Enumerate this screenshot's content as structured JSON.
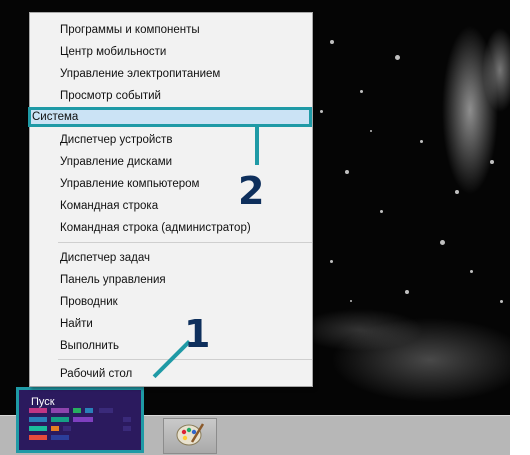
{
  "context_menu": {
    "items": [
      "Программы и компоненты",
      "Центр мобильности",
      "Управление электропитанием",
      "Просмотр событий",
      "Система",
      "Диспетчер устройств",
      "Управление дисками",
      "Управление компьютером",
      "Командная строка",
      "Командная строка (администратор)",
      "Диспетчер задач",
      "Панель управления",
      "Проводник",
      "Найти",
      "Выполнить",
      "Рабочий стол"
    ],
    "highlighted_index": 4
  },
  "start_button": {
    "label": "Пуск"
  },
  "callouts": {
    "one": "1",
    "two": "2"
  },
  "taskbar": {
    "apps": [
      "paint-icon"
    ]
  },
  "colors": {
    "accent": "#1f9aa6",
    "start_bg": "#2b1a5e",
    "highlight": "#cbe3f5",
    "callout_text": "#0e2f5c"
  }
}
